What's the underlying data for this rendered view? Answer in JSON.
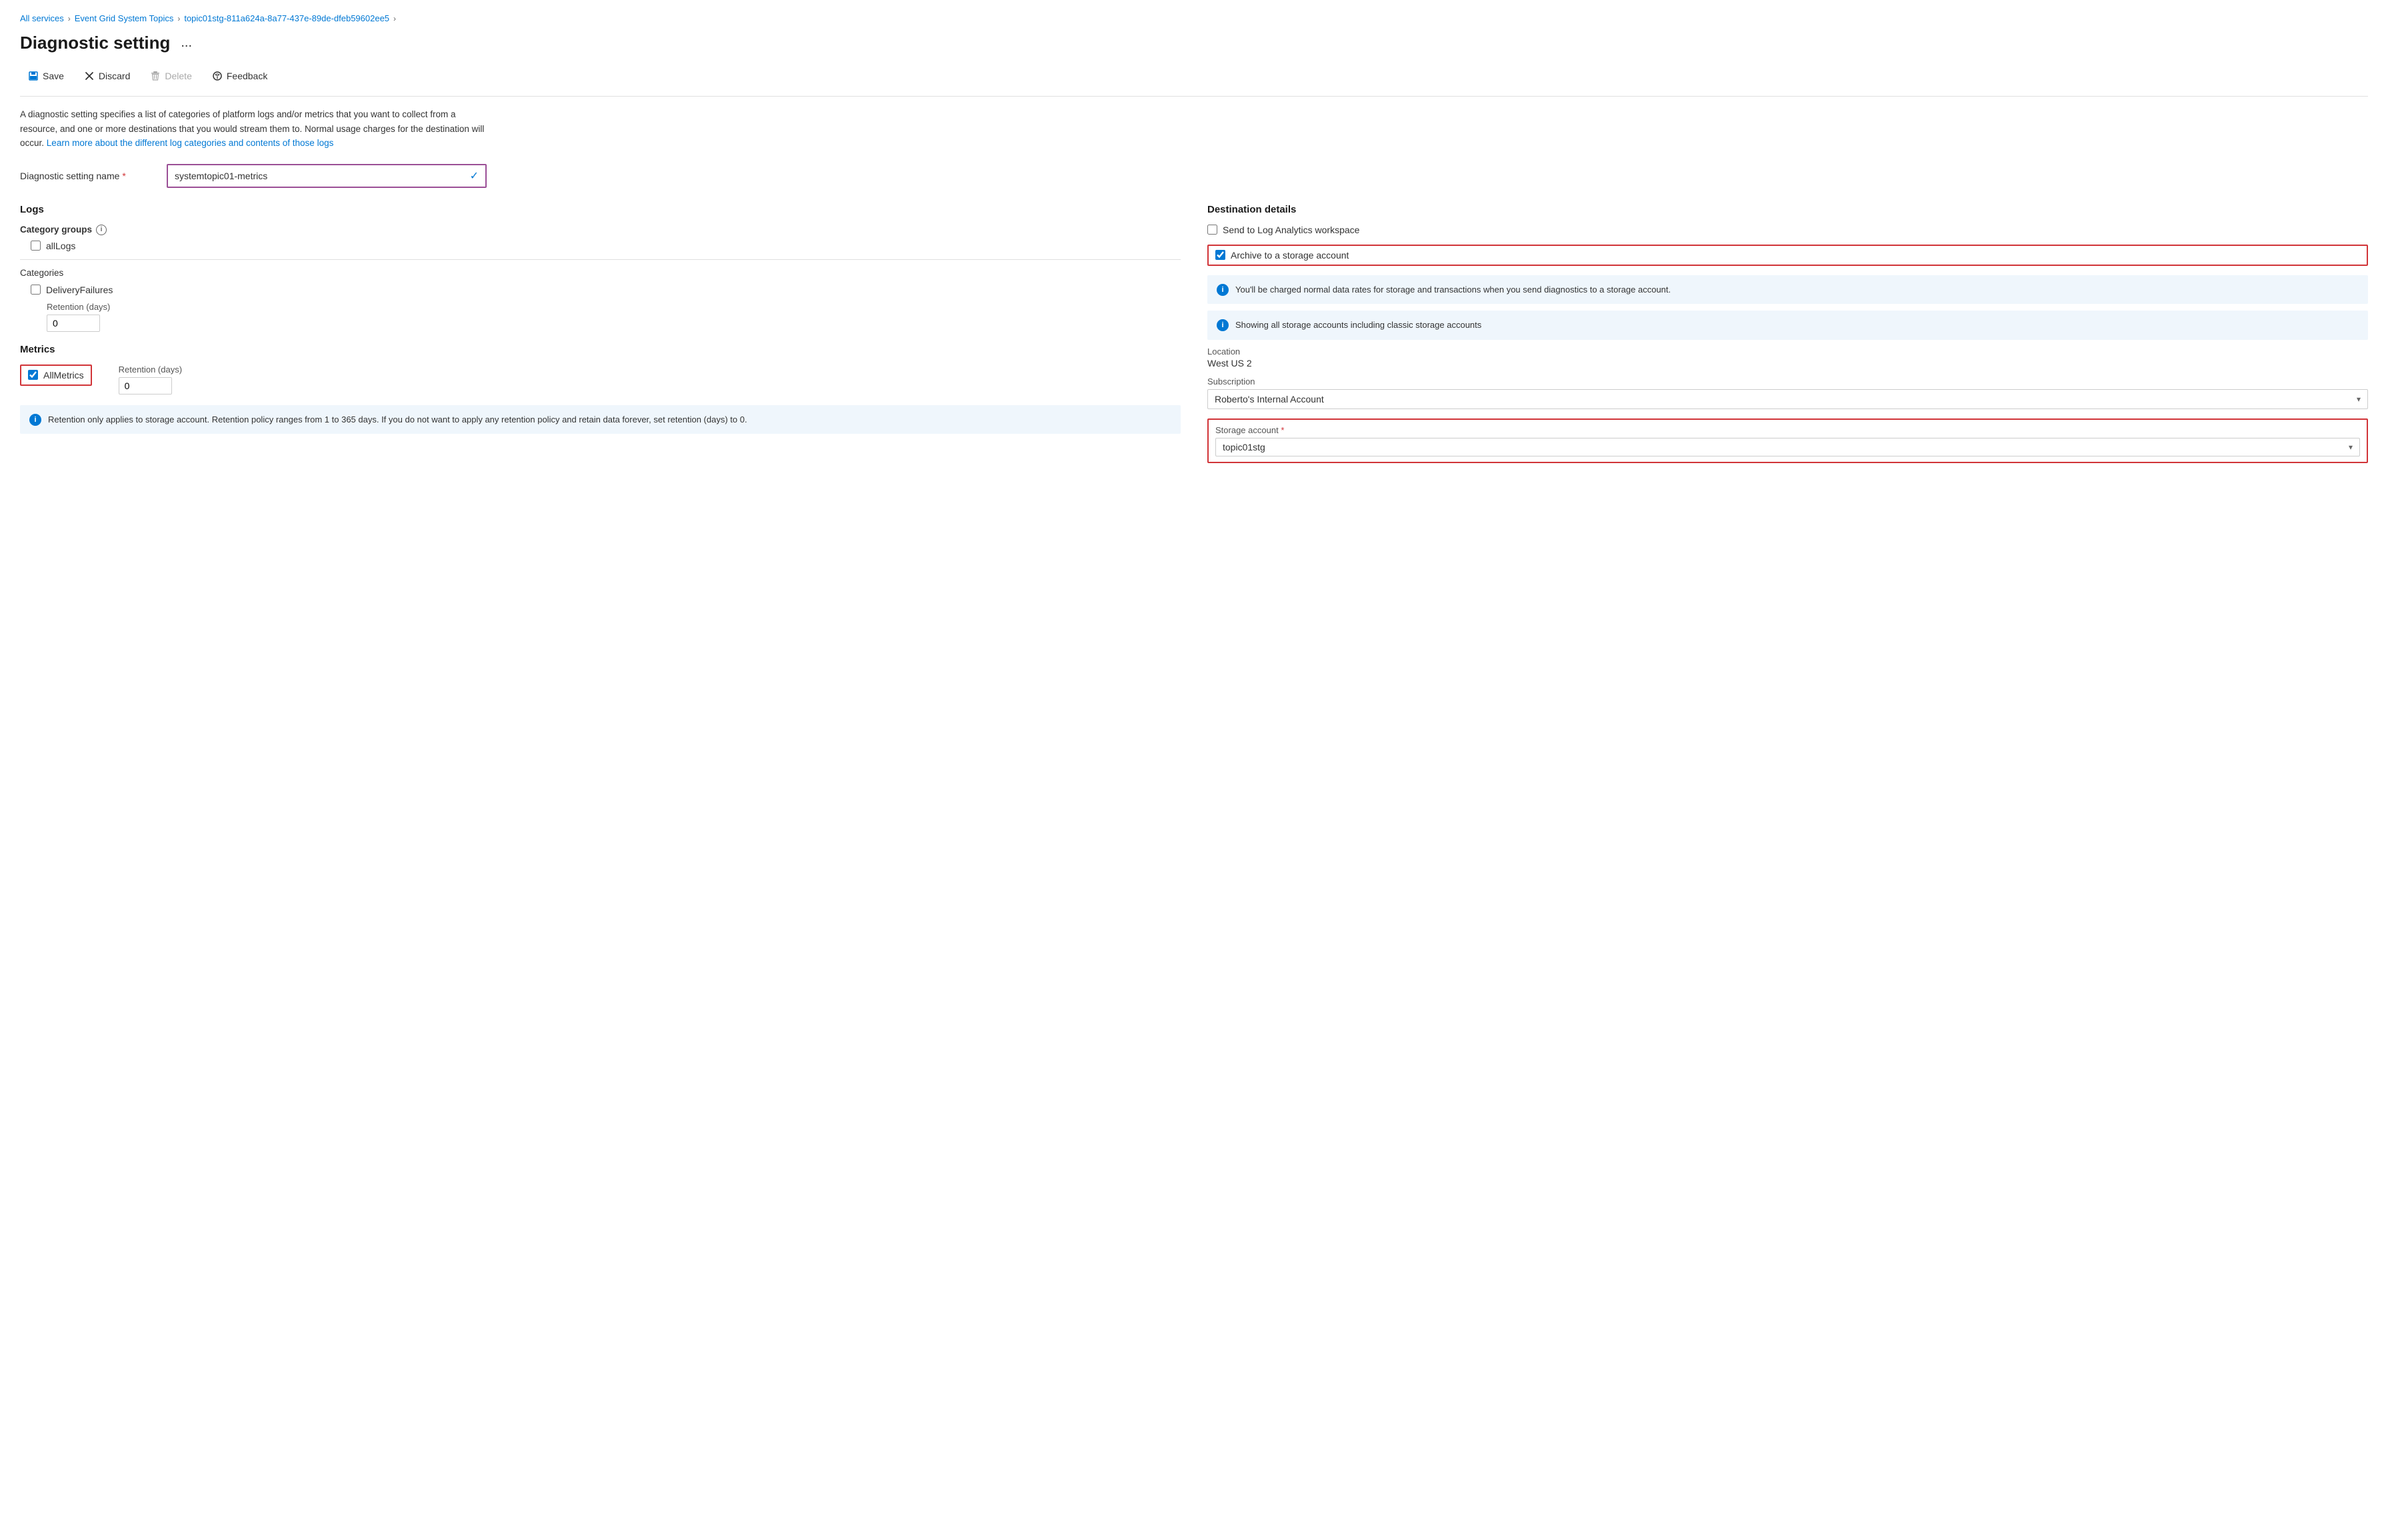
{
  "breadcrumb": {
    "items": [
      {
        "label": "All services",
        "href": "#"
      },
      {
        "label": "Event Grid System Topics",
        "href": "#"
      },
      {
        "label": "topic01stg-811a624a-8a77-437e-89de-dfeb59602ee5",
        "href": "#"
      }
    ]
  },
  "page": {
    "title": "Diagnostic setting",
    "ellipsis": "..."
  },
  "toolbar": {
    "save_label": "Save",
    "discard_label": "Discard",
    "delete_label": "Delete",
    "feedback_label": "Feedback"
  },
  "description": {
    "text": "A diagnostic setting specifies a list of categories of platform logs and/or metrics that you want to collect from a resource, and one or more destinations that you would stream them to. Normal usage charges for the destination will occur.",
    "link_text": "Learn more about the different log categories and contents of those logs"
  },
  "diag_name": {
    "label": "Diagnostic setting name",
    "required": "*",
    "value": "systemtopic01-metrics",
    "checkmark": "✓"
  },
  "logs": {
    "title": "Logs",
    "category_groups": {
      "label": "Category groups",
      "info_tooltip": "i",
      "items": [
        {
          "label": "allLogs",
          "checked": false
        }
      ]
    },
    "categories": {
      "label": "Categories",
      "items": [
        {
          "label": "DeliveryFailures",
          "checked": false,
          "retention_label": "Retention (days)",
          "retention_value": "0"
        }
      ]
    }
  },
  "metrics": {
    "title": "Metrics",
    "items": [
      {
        "label": "AllMetrics",
        "checked": true,
        "retention_label": "Retention (days)",
        "retention_value": "0"
      }
    ],
    "info_text": "Retention only applies to storage account. Retention policy ranges from 1 to 365 days. If you do not want to apply any retention policy and retain data forever, set retention (days) to 0."
  },
  "destination": {
    "title": "Destination details",
    "log_analytics": {
      "label": "Send to Log Analytics workspace",
      "checked": false
    },
    "archive": {
      "label": "Archive to a storage account",
      "checked": true
    },
    "info1": "You'll be charged normal data rates for storage and transactions when you send diagnostics to a storage account.",
    "info2": "Showing all storage accounts including classic storage accounts",
    "location": {
      "label": "Location",
      "value": "West US 2"
    },
    "subscription": {
      "label": "Subscription",
      "value": "Roberto's Internal Account"
    },
    "storage_account": {
      "label": "Storage account",
      "required": "*",
      "value": "topic01stg"
    }
  }
}
